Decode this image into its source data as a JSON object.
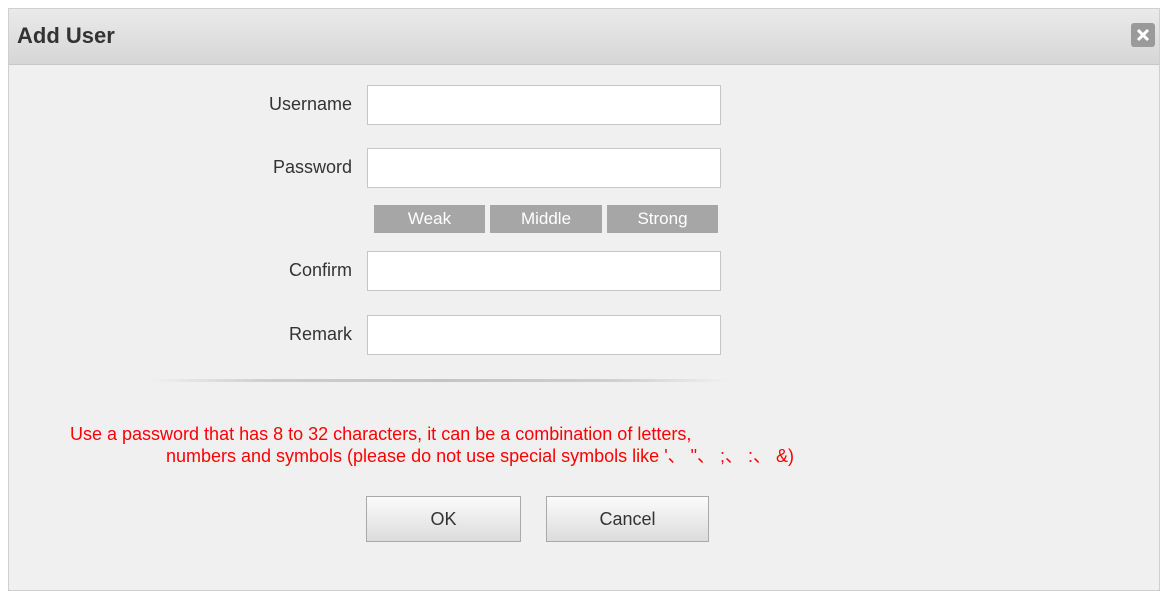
{
  "dialog": {
    "title": "Add User",
    "close_icon": "close-icon"
  },
  "form": {
    "username_label": "Username",
    "username_value": "",
    "password_label": "Password",
    "password_value": "",
    "confirm_label": "Confirm",
    "confirm_value": "",
    "remark_label": "Remark",
    "remark_value": ""
  },
  "strength": {
    "weak": "Weak",
    "middle": "Middle",
    "strong": "Strong",
    "indicator_color": "#a6a6a6"
  },
  "hint": {
    "line1": "Use a password that has 8 to 32 characters, it can be a combination of letters,",
    "line2": "numbers and symbols (please do not use special symbols like '、 \"、 ;、 :、 &)",
    "color": "#ff0000"
  },
  "buttons": {
    "ok": "OK",
    "cancel": "Cancel"
  }
}
